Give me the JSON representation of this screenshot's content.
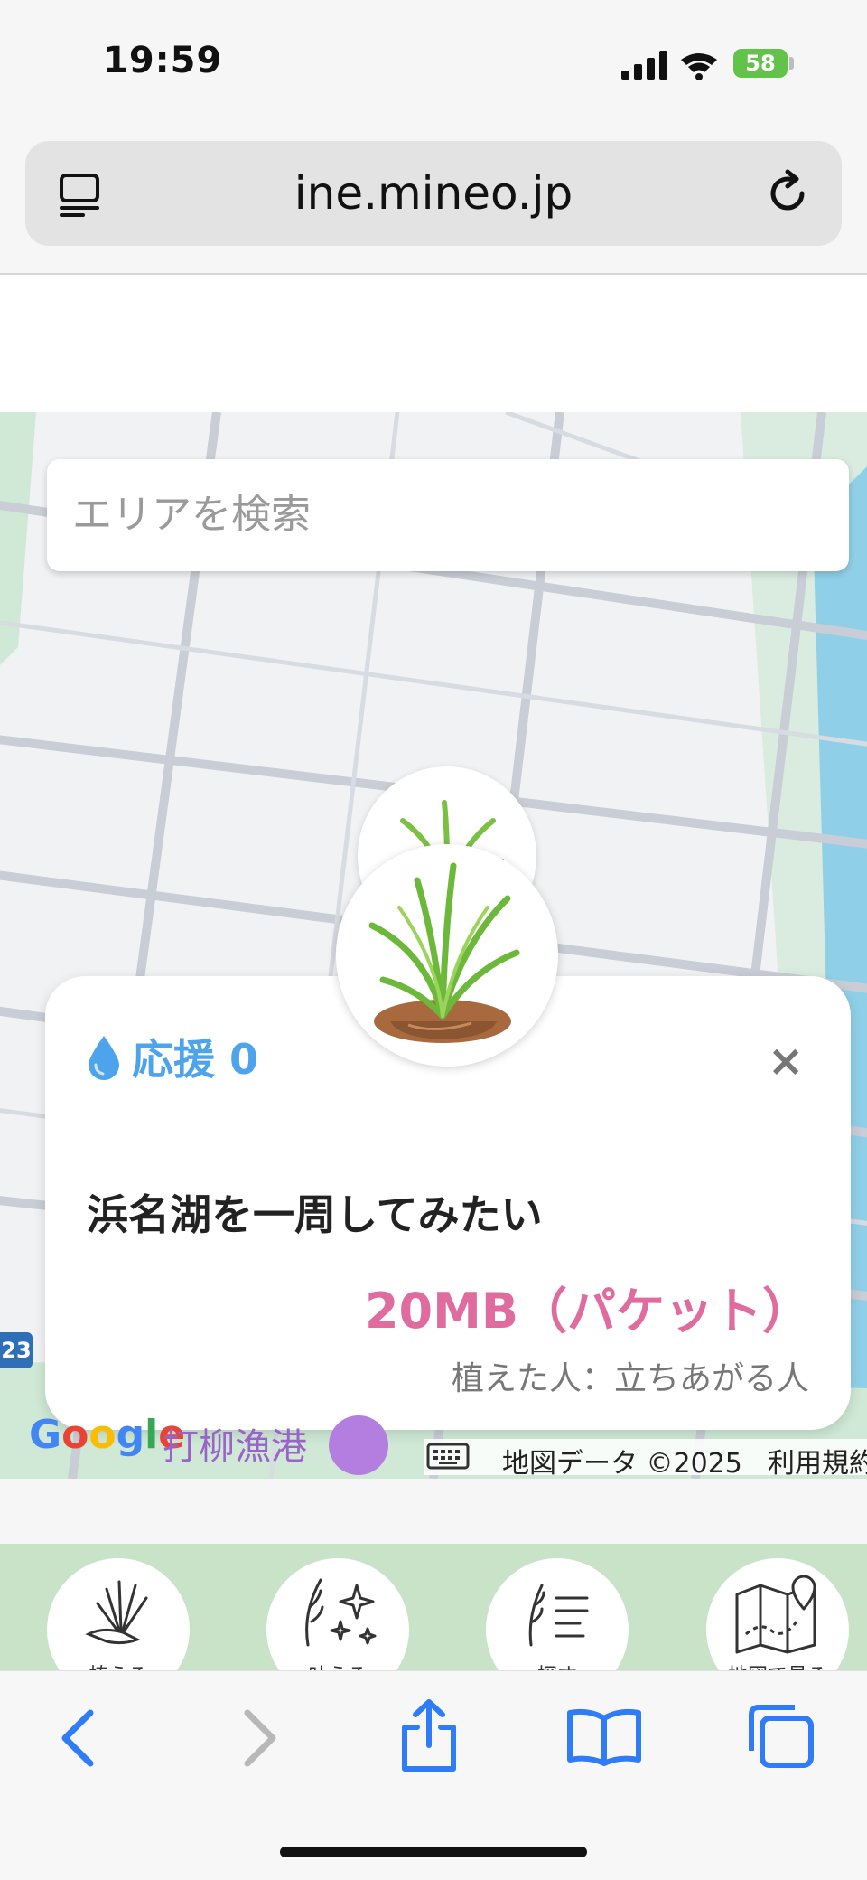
{
  "status_bar": {
    "time": "19:59",
    "battery": "58"
  },
  "browser": {
    "url": "ine.mineo.jp"
  },
  "map": {
    "search_placeholder": "エリアを検索",
    "google_logo": "Google",
    "poi_label": "打柳漁港",
    "map_data": "地図データ ©2025",
    "terms": "利用規約",
    "route_number": "23"
  },
  "card": {
    "support_label": "応援 0",
    "close": "×",
    "wish": "浜名湖を一周してみたい",
    "packet": "20MB（パケット）",
    "planter": "植えた人：立ちあがる人"
  },
  "nav": {
    "items": [
      {
        "label": "植える"
      },
      {
        "label": "叶える"
      },
      {
        "label": "探す"
      },
      {
        "label": "地図で見る"
      }
    ]
  },
  "colors": {
    "accent_blue": "#4da3ec",
    "packet_pink": "#e06c9f",
    "nav_green": "#c9e3c9",
    "ios_blue": "#2f7cf6"
  }
}
